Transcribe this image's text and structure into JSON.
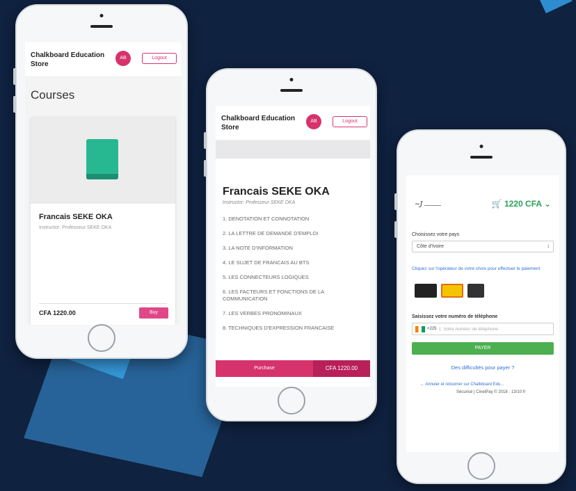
{
  "store_name": "Chalkboard Education Store",
  "avatar_initials": "AB",
  "logout_label": "Logout",
  "courses_screen": {
    "title": "Courses",
    "card": {
      "title": "Francais SEKE OKA",
      "instructor": "Instructor: Professeur SEKE OKA",
      "price": "CFA 1220.00",
      "buy_label": "Buy"
    }
  },
  "course_screen": {
    "title": "Francais SEKE OKA",
    "instructor": "Instructor: Professeur SEKE OKA",
    "lessons": [
      "1. DENOTATION ET CONNOTATION",
      "2. LA LETTRE DE DEMANDE D'EMPLOI",
      "3. LA NOTE D'INFORMATION",
      "4. LE SUJET DE FRANCAIS AU BTS",
      "5. LES CONNECTEURS LOGIQUES",
      "6. LES FACTEURS ET FONCTIONS DE LA COMMUNICATION",
      "7. LES VERBES PRONOMINAUX",
      "8. TECHNIQUES D'EXPRESSION FRANCAISE"
    ],
    "purchase_label": "Purchase",
    "purchase_price": "CFA 1220.00"
  },
  "payment_screen": {
    "cart_amount": "1220 CFA",
    "country_label": "Choisissez votre pays",
    "country_value": "Côte d'Ivoire",
    "operator_label": "Cliquez sur l'opérateur de votre choix pour effectuer le paiement",
    "phone_label": "Saisissez votre numéro de téléphone",
    "country_code": "+225",
    "phone_placeholder": "Votre numéro de téléphone",
    "pay_button": "PAYER",
    "help_link": "Des difficultés pour payer ?",
    "back_link": "← Annuler et retourner sur Chalkboard Edu...",
    "footer": "Sécurisé | CinetPay © 2018 · 13/10 fr"
  }
}
